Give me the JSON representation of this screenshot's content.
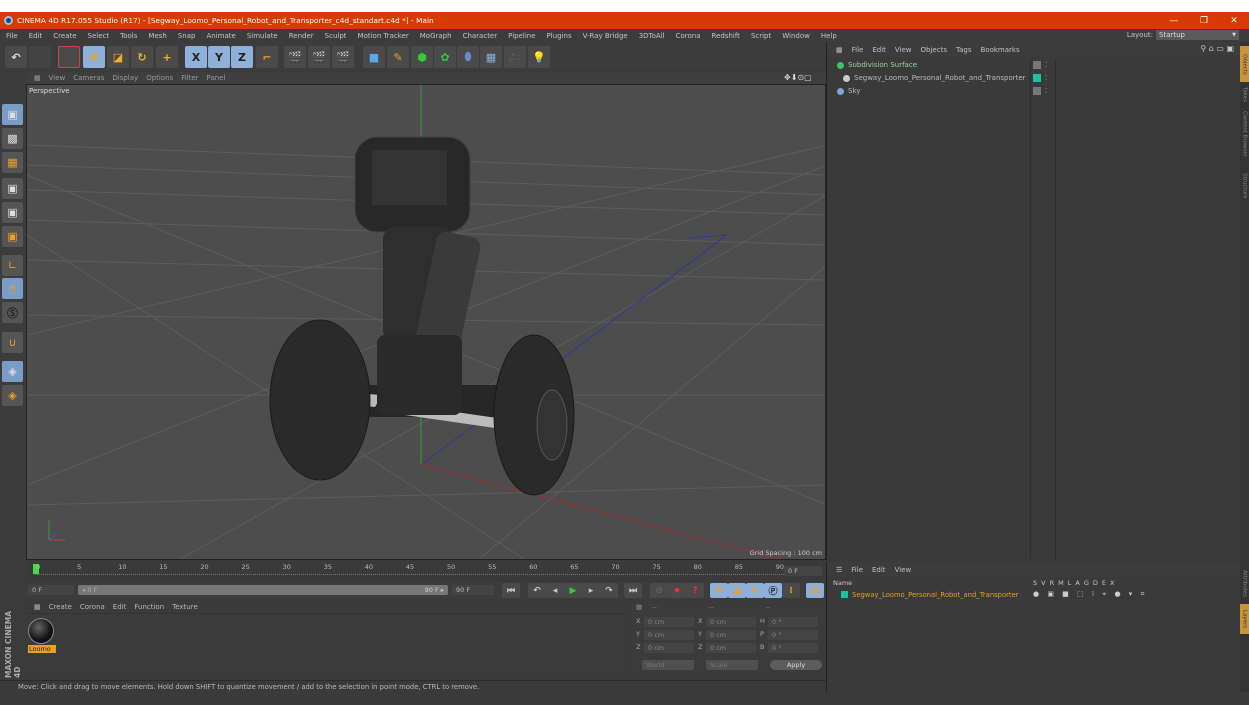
{
  "window": {
    "title": "CINEMA 4D R17.055 Studio (R17) - [Segway_Loomo_Personal_Robot_and_Transporter_c4d_standart.c4d *] - Main",
    "minimize": "—",
    "restore": "❐",
    "close": "✕"
  },
  "menubar": [
    "File",
    "Edit",
    "Create",
    "Select",
    "Tools",
    "Mesh",
    "Snap",
    "Animate",
    "Simulate",
    "Render",
    "Sculpt",
    "Motion Tracker",
    "MoGraph",
    "Character",
    "Pipeline",
    "Plugins",
    "V-Ray Bridge",
    "3DToAll",
    "Corona",
    "Redshift",
    "Script",
    "Window",
    "Help"
  ],
  "layout": {
    "label": "Layout:",
    "value": "Startup"
  },
  "toolbar": {
    "undo": "↶",
    "axis_x": "X",
    "axis_y": "Y",
    "axis_z": "Z"
  },
  "viewport": {
    "menu": [
      "View",
      "Cameras",
      "Display",
      "Options",
      "Filter",
      "Panel"
    ],
    "label": "Perspective",
    "grid_spacing": "Grid Spacing : 100 cm",
    "nav_icons": "✥⬇⊙▢"
  },
  "timeline": {
    "ticks": [
      "0",
      "5",
      "10",
      "15",
      "20",
      "25",
      "30",
      "35",
      "40",
      "45",
      "50",
      "55",
      "60",
      "65",
      "70",
      "75",
      "80",
      "85",
      "90"
    ],
    "current_frame": "0 F",
    "start": "0 F",
    "slider_left": "◂ 0 F",
    "slider_right": "90 F ▸",
    "end": "90 F"
  },
  "materials": {
    "menu": [
      "Create",
      "Corona",
      "Edit",
      "Function",
      "Texture"
    ],
    "items": [
      {
        "name": "Loomo"
      }
    ]
  },
  "brand": "MAXON CINEMA 4D",
  "coordinates": {
    "headers": [
      "--",
      "--",
      "--"
    ],
    "rows": [
      {
        "a": "X",
        "av": "0 cm",
        "b": "X",
        "bv": "0 cm",
        "c": "H",
        "cv": "0 °"
      },
      {
        "a": "Y",
        "av": "0 cm",
        "b": "Y",
        "bv": "0 cm",
        "c": "P",
        "cv": "0 °"
      },
      {
        "a": "Z",
        "av": "0 cm",
        "b": "Z",
        "bv": "0 cm",
        "c": "B",
        "cv": "0 °"
      }
    ],
    "mode": "World",
    "size_mode": "Scale",
    "apply": "Apply"
  },
  "status": "Move: Click and drag to move elements. Hold down SHIFT to quantize movement / add to the selection in point mode, CTRL to remove.",
  "object_manager": {
    "menu": [
      "File",
      "Edit",
      "View",
      "Objects",
      "Tags",
      "Bookmarks"
    ],
    "objects": [
      {
        "name": "Subdivision Surface",
        "icon_color": "#3fc26b"
      },
      {
        "name": "Segway_Loomo_Personal_Robot_and_Transporter",
        "icon_color": "#cccccc",
        "tag_color": "#1fc0a0"
      },
      {
        "name": "Sky",
        "icon_color": "#7aa6d8"
      }
    ]
  },
  "attributes": {
    "menu": [
      "File",
      "Edit",
      "View"
    ],
    "name_header": "Name",
    "columns": [
      "S",
      "V",
      "R",
      "M",
      "L",
      "A",
      "G",
      "D",
      "E",
      "X"
    ],
    "row": {
      "name": "Segway_Loomo_Personal_Robot_and_Transporter",
      "color": "#1fc0a0"
    }
  },
  "side_tabs": [
    "Objects",
    "Takes",
    "Content Browser",
    "Structure",
    "Attributes",
    "Layers"
  ]
}
